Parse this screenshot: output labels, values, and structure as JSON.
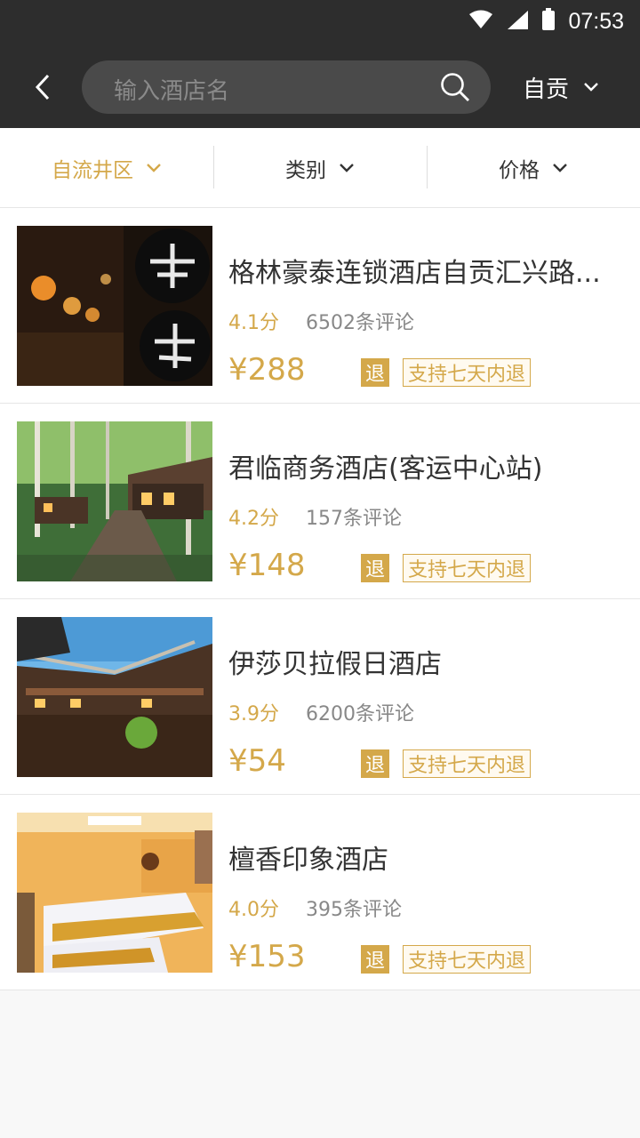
{
  "status_bar": {
    "time": "07:53",
    "icons": [
      "wifi-icon",
      "signal-icon",
      "battery-icon"
    ]
  },
  "header": {
    "back_icon": "chevron-left-icon",
    "search": {
      "placeholder": "输入酒店名",
      "icon": "search-icon"
    },
    "city": {
      "label": "自贡",
      "icon": "chevron-down-icon"
    }
  },
  "filters": [
    {
      "label": "自流井区",
      "active": true
    },
    {
      "label": "类别",
      "active": false
    },
    {
      "label": "价格",
      "active": false
    }
  ],
  "hotels": [
    {
      "name": "格林豪泰连锁酒店自贡汇兴路...",
      "score": "4.1分",
      "reviews": "6502条评论",
      "price": "¥288",
      "refund_badge": "退",
      "refund_tag": "支持七天内退",
      "image": "inn-lanterns-photo"
    },
    {
      "name": "君临商务酒店(客运中心站)",
      "score": "4.2分",
      "reviews": "157条评论",
      "price": "¥148",
      "refund_badge": "退",
      "refund_tag": "支持七天内退",
      "image": "forest-cabins-photo"
    },
    {
      "name": "伊莎贝拉假日酒店",
      "score": "3.9分",
      "reviews": "6200条评论",
      "price": "¥54",
      "refund_badge": "退",
      "refund_tag": "支持七天内退",
      "image": "courtyard-building-photo"
    },
    {
      "name": "檀香印象酒店",
      "score": "4.0分",
      "reviews": "395条评论",
      "price": "¥153",
      "refund_badge": "退",
      "refund_tag": "支持七天内退",
      "image": "hotel-room-photo"
    }
  ],
  "colors": {
    "accent": "#d4a84a",
    "header_bg": "#2d2d2d",
    "text": "#333333",
    "muted": "#888888"
  }
}
